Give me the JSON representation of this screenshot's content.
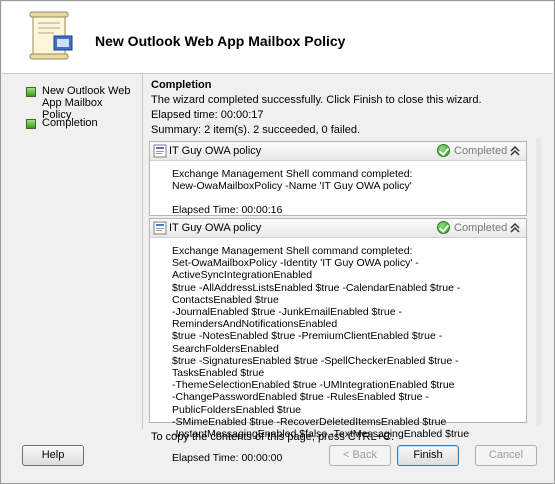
{
  "header": {
    "title": "New Outlook Web App Mailbox Policy"
  },
  "sidebar": {
    "steps": [
      {
        "label": "New Outlook Web App Mailbox Policy"
      },
      {
        "label": "Completion"
      }
    ]
  },
  "content": {
    "title": "Completion",
    "message": "The wizard completed successfully. Click Finish to close this wizard.",
    "elapsed": "Elapsed time: 00:00:17",
    "summary": "Summary: 2 item(s). 2 succeeded, 0 failed."
  },
  "results": [
    {
      "title": "IT Guy OWA policy",
      "status": "Completed",
      "command": "Exchange Management Shell command completed:\nNew-OwaMailboxPolicy -Name 'IT Guy OWA policy'",
      "elapsed": "Elapsed Time: 00:00:16"
    },
    {
      "title": "IT Guy OWA policy",
      "status": "Completed",
      "command": "Exchange Management Shell command completed:\nSet-OwaMailboxPolicy -Identity 'IT Guy OWA policy' -ActiveSyncIntegrationEnabled\n$true -AllAddressListsEnabled $true -CalendarEnabled $true -ContactsEnabled $true\n-JournalEnabled $true -JunkEmailEnabled $true -RemindersAndNotificationsEnabled\n$true -NotesEnabled $true -PremiumClientEnabled $true -SearchFoldersEnabled\n$true -SignaturesEnabled $true -SpellCheckerEnabled $true -TasksEnabled $true\n-ThemeSelectionEnabled $true -UMIntegrationEnabled $true\n-ChangePasswordEnabled $true -RulesEnabled $true -PublicFoldersEnabled $true\n-SMimeEnabled $true -RecoverDeletedItemsEnabled $true\n-InstantMessagingEnabled $false -TextMessagingEnabled $true",
      "elapsed": "Elapsed Time: 00:00:00"
    }
  ],
  "footer": {
    "hint": "To copy the contents of this page, press CTRL+C.",
    "help_label": "Help",
    "back_label": "< Back",
    "finish_label": "Finish",
    "cancel_label": "Cancel"
  }
}
